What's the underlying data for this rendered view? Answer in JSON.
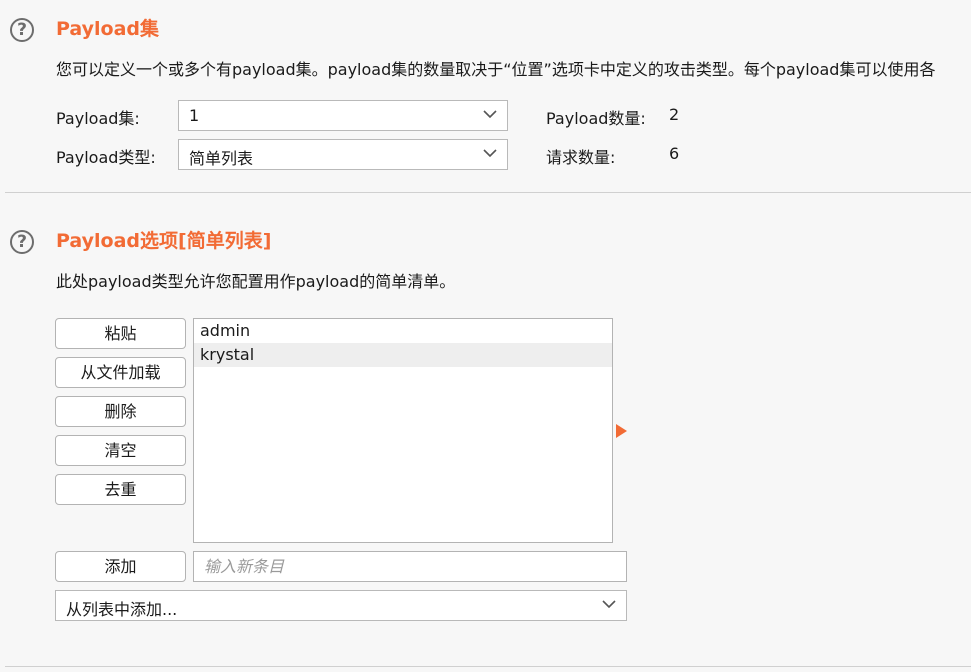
{
  "payload_sets": {
    "title": "Payload集",
    "description": "您可以定义一个或多个有payload集。payload集的数量取决于“位置”选项卡中定义的攻击类型。每个payload集可以使用各",
    "set_label": "Payload集:",
    "set_value": "1",
    "type_label": "Payload类型:",
    "type_value": "简单列表",
    "count_label": "Payload数量:",
    "count_value": "2",
    "request_label": "请求数量:",
    "request_value": "6"
  },
  "payload_options": {
    "title": "Payload选项[简单列表]",
    "description": "此处payload类型允许您配置用作payload的简单清单。",
    "buttons": {
      "paste": "粘贴",
      "load": "从文件加载",
      "remove": "删除",
      "clear": "清空",
      "dedupe": "去重",
      "add": "添加"
    },
    "items": [
      "admin",
      "krystal"
    ],
    "new_item_placeholder": "输入新条目",
    "add_from_list": "从列表中添加..."
  },
  "colors": {
    "accent": "#f26b35",
    "background": "#f7f7f7"
  },
  "icons": {
    "help": "question-circle-icon",
    "dropdown": "chevron-down-icon",
    "expand": "triangle-right-icon"
  }
}
